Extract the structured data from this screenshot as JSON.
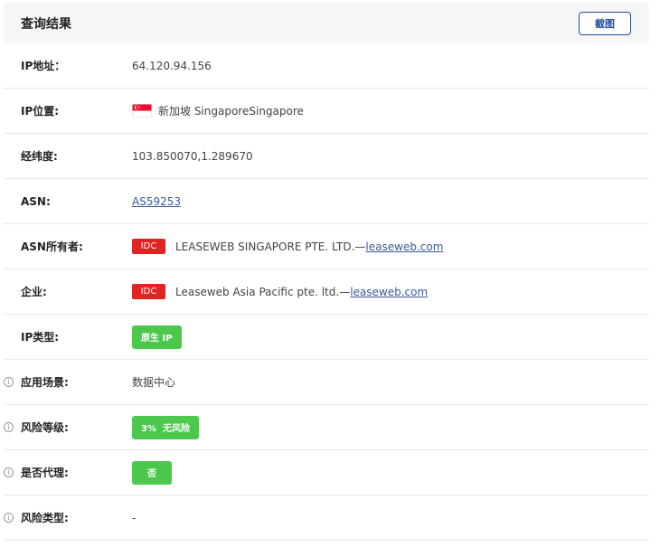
{
  "header": {
    "title": "查询结果",
    "screenshot_button": "截图"
  },
  "rows": {
    "ip": {
      "label": "IP地址：",
      "value": "64.120.94.156"
    },
    "location": {
      "label": "IP位置:",
      "flag_icon": "singapore-flag-icon",
      "value": "新加坡 SingaporeSingapore"
    },
    "coords": {
      "label": "经纬度:",
      "value": "103.850070,1.289670"
    },
    "asn": {
      "label": "ASN:",
      "value": "AS59253"
    },
    "asn_owner": {
      "label": "ASN所有者:",
      "tag": "IDC",
      "text": "LEASEWEB SINGAPORE PTE. LTD.—",
      "link": "leaseweb.com"
    },
    "company": {
      "label": "企业:",
      "tag": "IDC",
      "text": "Leaseweb Asia Pacific pte. ltd.—",
      "link": "leaseweb.com"
    },
    "ip_type": {
      "label": "IP类型:",
      "badge": "原生 IP"
    },
    "scenario": {
      "label": "应用场景:",
      "value": "数据中心"
    },
    "risk_level": {
      "label": "风险等级:",
      "badge": "3%  无风险"
    },
    "proxy": {
      "label": "是否代理:",
      "badge": "否"
    },
    "risk_type": {
      "label": "风险类型:",
      "value": "-"
    }
  },
  "colors": {
    "idc_red": "#e02424",
    "badge_green": "#4cc94c",
    "link_blue": "#3b5998",
    "button_blue": "#1f4e9e"
  }
}
